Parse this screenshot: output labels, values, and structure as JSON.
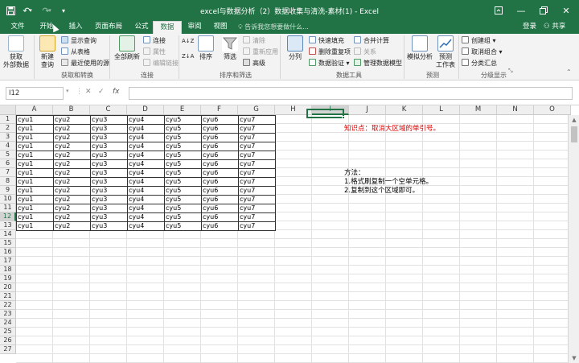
{
  "window": {
    "title": "excel与数据分析（2）数据收集与清洗-素材(1) - Excel",
    "controls": [
      "ribbon-display-icon",
      "minimize-icon",
      "restore-icon",
      "close-icon"
    ]
  },
  "quick_access": [
    "save-icon",
    "undo-icon",
    "redo-icon",
    "customize-icon"
  ],
  "tabs": [
    {
      "label": "文件"
    },
    {
      "label": "开始"
    },
    {
      "label": "插入"
    },
    {
      "label": "页面布局"
    },
    {
      "label": "公式"
    },
    {
      "label": "数据"
    },
    {
      "label": "审阅"
    },
    {
      "label": "视图"
    }
  ],
  "active_tab": "数据",
  "tell_me": "告诉我您想要做什么...",
  "account": {
    "login": "登录",
    "share": "共享"
  },
  "ribbon": {
    "get_external": "获取\n外部数据",
    "new_query": "新建\n查询",
    "show_queries": "显示查询",
    "from_table": "从表格",
    "recent_sources": "最近使用的源",
    "group_get_transform": "获取和转换",
    "refresh_all": "全部刷新",
    "connections": "连接",
    "properties": "属性",
    "edit_links": "编辑链接",
    "group_connections": "连接",
    "sort_az": "A↓Z",
    "sort_za": "Z↓A",
    "sort": "排序",
    "filter": "筛选",
    "clear": "清除",
    "reapply": "重新应用",
    "advanced": "高级",
    "group_sort_filter": "排序和筛选",
    "text_to_columns": "分列",
    "flash_fill": "快速填充",
    "remove_duplicates": "删除重复项",
    "data_validation": "数据验证",
    "consolidate": "合并计算",
    "relationships": "关系",
    "data_model": "管理数据模型",
    "group_data_tools": "数据工具",
    "what_if": "模拟分析",
    "forecast_sheet": "预测\n工作表",
    "group_forecast": "预测",
    "group": "创建组",
    "ungroup": "取消组合",
    "subtotal": "分类汇总",
    "group_outline": "分级显示"
  },
  "formula_bar": {
    "name_box": "I12",
    "cancel": "✕",
    "enter": "✓",
    "fx": "fx",
    "value": ""
  },
  "columns": [
    "A",
    "B",
    "C",
    "D",
    "E",
    "F",
    "G",
    "H",
    "I",
    "J",
    "K",
    "L",
    "M",
    "N",
    "O"
  ],
  "rows": [
    "1",
    "2",
    "3",
    "4",
    "5",
    "6",
    "7",
    "8",
    "9",
    "10",
    "11",
    "12",
    "13",
    "14",
    "15",
    "16",
    "17",
    "18",
    "19",
    "20",
    "21",
    "22",
    "23",
    "24",
    "25",
    "26",
    "27"
  ],
  "selected": {
    "column": "I",
    "row": "12"
  },
  "table_row": [
    "cyu1",
    "cyu2",
    "cyu3",
    "cyu4",
    "cyu5",
    "cyu6",
    "cyu7"
  ],
  "notes": {
    "knowledge": "知识点：取消大区域的单引号。",
    "method_title": "方法：",
    "step1": "1.格式刷复制一个空单元格。",
    "step2": "2.复制到这个区域即可。"
  },
  "colors": {
    "brand": "#217346",
    "note_red": "#e00000"
  }
}
